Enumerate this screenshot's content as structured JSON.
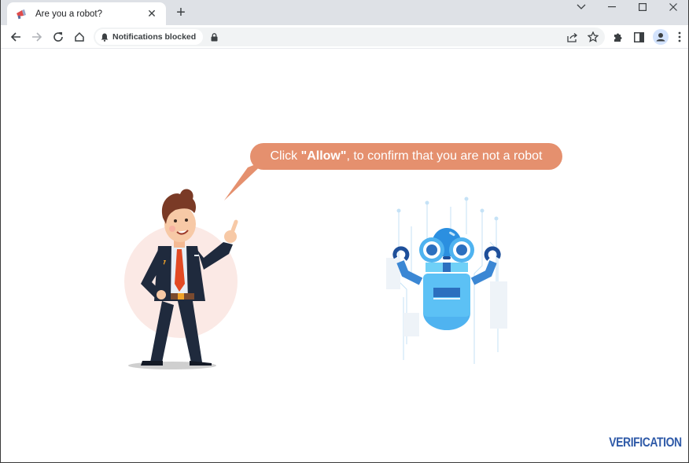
{
  "browser": {
    "tab": {
      "title": "Are you a robot?",
      "favicon": "megaphone-icon",
      "close_label": "✕"
    },
    "new_tab_label": "+",
    "window_controls": {
      "tab_search": "⌄",
      "minimize": "─",
      "maximize": "☐",
      "close": "✕"
    },
    "toolbar": {
      "back_icon": "arrow-left-icon",
      "forward_icon": "arrow-right-icon",
      "reload_icon": "reload-icon",
      "home_icon": "home-icon",
      "notification_chip_label": "Notifications blocked",
      "url": ""
    }
  },
  "page": {
    "bubble": {
      "prefix": "Click ",
      "highlight": "\"Allow\"",
      "suffix": ", to confirm that you are not a robot"
    },
    "brand_label": "VERIFICATION",
    "colors": {
      "bubble": "#e5906e",
      "brand": "#2f5aa8",
      "robot_body": "#4fb3f0",
      "robot_dark": "#2b6fbf",
      "suit": "#1f2a3d",
      "tie": "#e24a24",
      "circle": "#fbe9e5"
    }
  }
}
